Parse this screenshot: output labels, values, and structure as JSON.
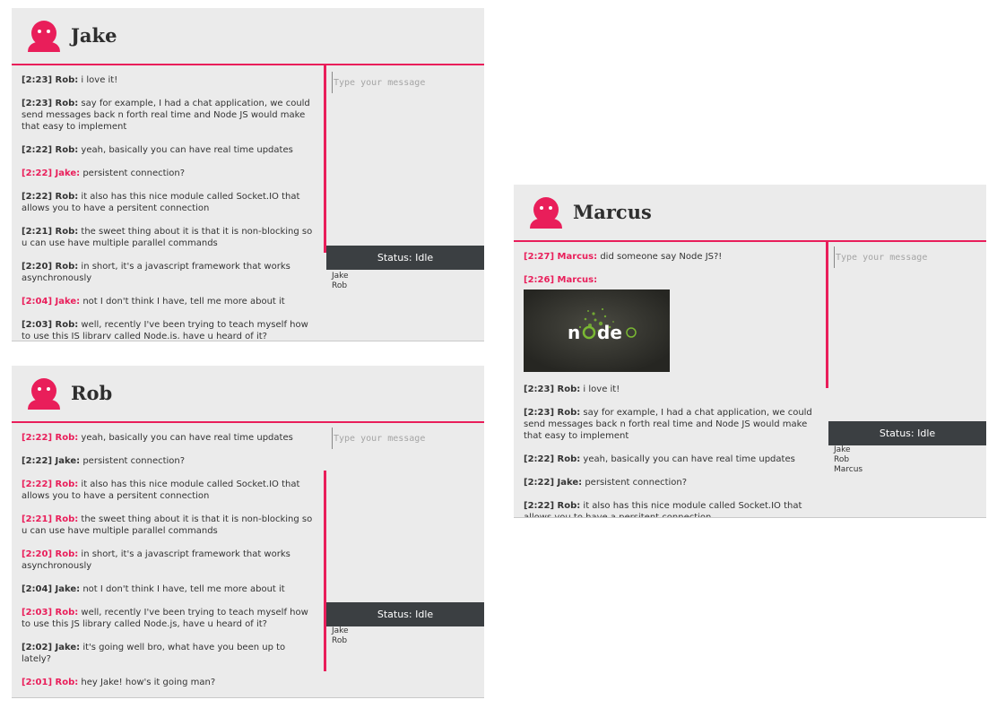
{
  "placeholder": "Type your message",
  "status_label": "Status: Idle",
  "colors": {
    "accent": "#e91e5a",
    "panel_bg": "#ebebeb",
    "status_bg": "#3b3f42"
  },
  "panels": [
    {
      "title": "Jake",
      "messages": [
        {
          "time": "[2:23]",
          "sender": "Rob:",
          "text": "i love it!",
          "highlight": false
        },
        {
          "time": "[2:23]",
          "sender": "Rob:",
          "text": "say for example, I had a chat application, we could send messages back n forth real time and Node JS would make that easy to implement",
          "highlight": false
        },
        {
          "time": "[2:22]",
          "sender": "Rob:",
          "text": "yeah, basically you can have real time updates",
          "highlight": false
        },
        {
          "time": "[2:22]",
          "sender": "Jake:",
          "text": "persistent connection?",
          "highlight": true
        },
        {
          "time": "[2:22]",
          "sender": "Rob:",
          "text": "it also has this nice module called Socket.IO that allows you to have a persitent connection",
          "highlight": false
        },
        {
          "time": "[2:21]",
          "sender": "Rob:",
          "text": "the sweet thing about it is that it is non-blocking so u can use have multiple parallel commands",
          "highlight": false
        },
        {
          "time": "[2:20]",
          "sender": "Rob:",
          "text": "in short, it's a javascript framework that works asynchronously",
          "highlight": false
        },
        {
          "time": "[2:04]",
          "sender": "Jake:",
          "text": "not I don't think I have, tell me more about it",
          "highlight": true
        },
        {
          "time": "[2:03]",
          "sender": "Rob:",
          "text": "well, recently I've been trying to teach myself how to use this JS library called Node.js, have u heard of it?",
          "highlight": false
        }
      ],
      "users": [
        "Jake",
        "Rob"
      ]
    },
    {
      "title": "Rob",
      "messages": [
        {
          "time": "[2:22]",
          "sender": "Rob:",
          "text": "yeah, basically you can have real time updates",
          "highlight": true
        },
        {
          "time": "[2:22]",
          "sender": "Jake:",
          "text": "persistent connection?",
          "highlight": false
        },
        {
          "time": "[2:22]",
          "sender": "Rob:",
          "text": "it also has this nice module called Socket.IO that allows you to have a persitent connection",
          "highlight": true
        },
        {
          "time": "[2:21]",
          "sender": "Rob:",
          "text": "the sweet thing about it is that it is non-blocking so u can use have multiple parallel commands",
          "highlight": true
        },
        {
          "time": "[2:20]",
          "sender": "Rob:",
          "text": "in short, it's a javascript framework that works asynchronously",
          "highlight": true
        },
        {
          "time": "[2:04]",
          "sender": "Jake:",
          "text": "not I don't think I have, tell me more about it",
          "highlight": false
        },
        {
          "time": "[2:03]",
          "sender": "Rob:",
          "text": "well, recently I've been trying to teach myself how to use this JS library called Node.js, have u heard of it?",
          "highlight": true
        },
        {
          "time": "[2:02]",
          "sender": "Jake:",
          "text": "it's going well bro, what have you been up to lately?",
          "highlight": false
        },
        {
          "time": "[2:01]",
          "sender": "Rob:",
          "text": "hey Jake! how's it going man?",
          "highlight": true
        }
      ],
      "users": [
        "Jake",
        "Rob"
      ]
    },
    {
      "title": "Marcus",
      "messages": [
        {
          "time": "[2:27]",
          "sender": "Marcus:",
          "text": "did someone say Node JS?!",
          "highlight": true
        },
        {
          "time": "[2:26]",
          "sender": "Marcus:",
          "text": "",
          "highlight": true,
          "image": "nodejs-logo-image"
        },
        {
          "time": "[2:23]",
          "sender": "Rob:",
          "text": "i love it!",
          "highlight": false
        },
        {
          "time": "[2:23]",
          "sender": "Rob:",
          "text": "say for example, I had a chat application, we could send messages back n forth real time and Node JS would make that easy to implement",
          "highlight": false
        },
        {
          "time": "[2:22]",
          "sender": "Rob:",
          "text": "yeah, basically you can have real time updates",
          "highlight": false
        },
        {
          "time": "[2:22]",
          "sender": "Jake:",
          "text": "persistent connection?",
          "highlight": false
        },
        {
          "time": "[2:22]",
          "sender": "Rob:",
          "text": "it also has this nice module called Socket.IO that allows you to have a persitent connection",
          "highlight": false
        }
      ],
      "users": [
        "Jake",
        "Rob",
        "Marcus"
      ]
    }
  ]
}
